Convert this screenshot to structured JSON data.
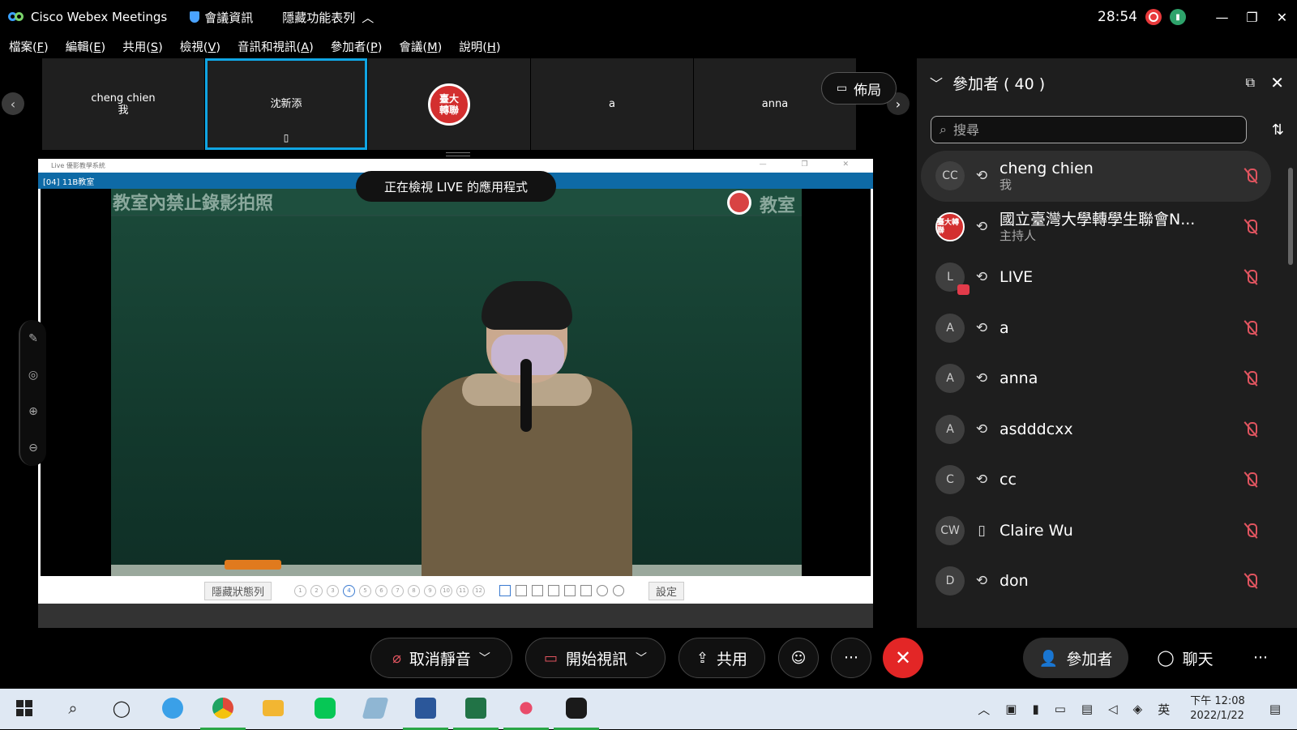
{
  "titlebar": {
    "app_name": "Cisco Webex Meetings",
    "meeting_info": "會議資訊",
    "hide_menu": "隱藏功能表列",
    "timer": "28:54",
    "window_min": "—",
    "window_restore": "❐",
    "window_close": "✕"
  },
  "menu": [
    {
      "label": "檔案(",
      "key": "F",
      "end": ")"
    },
    {
      "label": "編輯(",
      "key": "E",
      "end": ")"
    },
    {
      "label": "共用(",
      "key": "S",
      "end": ")"
    },
    {
      "label": "檢視(",
      "key": "V",
      "end": ")"
    },
    {
      "label": "音訊和視訊(",
      "key": "A",
      "end": ")"
    },
    {
      "label": "參加者(",
      "key": "P",
      "end": ")"
    },
    {
      "label": "會議(",
      "key": "M",
      "end": ")"
    },
    {
      "label": "說明(",
      "key": "H",
      "end": ")"
    }
  ],
  "thumbnails": {
    "t1_name": "cheng chien",
    "t1_sub": "我",
    "t2_name": "沈新添",
    "t4_name": "a",
    "t5_name": "anna",
    "stamp_text": "臺大轉聯",
    "layout_label": "佈局"
  },
  "share": {
    "window_title": "Live 優影教學系統",
    "room": "[04] 11B教室",
    "viewing_label": "正在檢視 LIVE 的應用程式",
    "banner_text": "教室內禁止錄影拍照",
    "banner_text2": "教室",
    "hide_status": "隱藏狀態列",
    "page_numbers": [
      "1",
      "2",
      "3",
      "4",
      "5",
      "6",
      "7",
      "8",
      "9",
      "10",
      "11",
      "12"
    ],
    "current_page": "4",
    "settings": "設定"
  },
  "participants": {
    "title": "參加者 ( 40 )",
    "search_placeholder": "搜尋",
    "list": [
      {
        "initials": "CC",
        "name": "cheng chien",
        "role": "我",
        "audio": "⟲"
      },
      {
        "initials": "臺大轉聯",
        "name": "國立臺灣大學轉學生聯會N...",
        "role": "主持人",
        "audio": "⟲"
      },
      {
        "initials": "L",
        "name": "LIVE",
        "role": "",
        "audio": "⟲"
      },
      {
        "initials": "A",
        "name": "a",
        "role": "",
        "audio": "⟲"
      },
      {
        "initials": "A",
        "name": "anna",
        "role": "",
        "audio": "⟲"
      },
      {
        "initials": "A",
        "name": "asdddcxx",
        "role": "",
        "audio": "⟲"
      },
      {
        "initials": "C",
        "name": "cc",
        "role": "",
        "audio": "⟲"
      },
      {
        "initials": "CW",
        "name": "Claire Wu",
        "role": "",
        "audio": "▯"
      },
      {
        "initials": "D",
        "name": "don",
        "role": "",
        "audio": "⟲"
      }
    ]
  },
  "controls": {
    "unmute": "取消靜音",
    "start_video": "開始視訊",
    "share": "共用",
    "more": "···",
    "participants": "參加者",
    "chat": "聊天",
    "more_right": "···"
  },
  "taskbar": {
    "ime": "英",
    "time": "下午 12:08",
    "date": "2022/1/22"
  },
  "colors": {
    "accent_blue": "#10a5e3",
    "end_red": "#e32626",
    "muted_red": "#e0545f",
    "panel_bg": "#1e1e1e"
  }
}
